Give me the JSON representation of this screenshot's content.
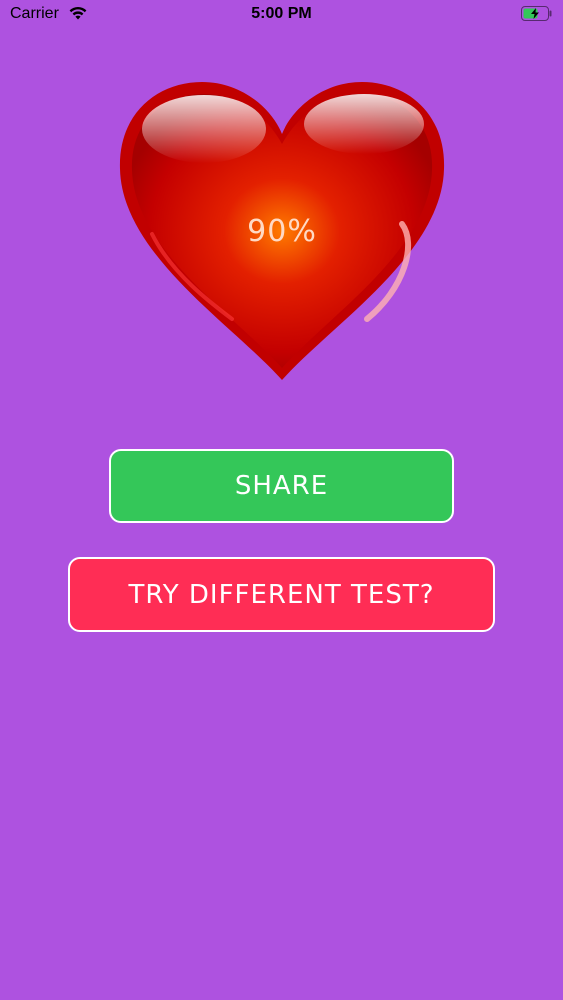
{
  "status_bar": {
    "carrier": "Carrier",
    "time": "5:00 PM",
    "wifi_icon": "wifi-icon",
    "battery_icon": "battery-charging-icon"
  },
  "result": {
    "percent": "90%",
    "heart_icon": "heart-icon"
  },
  "buttons": {
    "share_label": "SHARE",
    "try_label": "TRY DIFFERENT TEST?"
  },
  "colors": {
    "background": "#ae52e0",
    "share": "#34c759",
    "try": "#ff2d55",
    "heart": "#d10000"
  }
}
